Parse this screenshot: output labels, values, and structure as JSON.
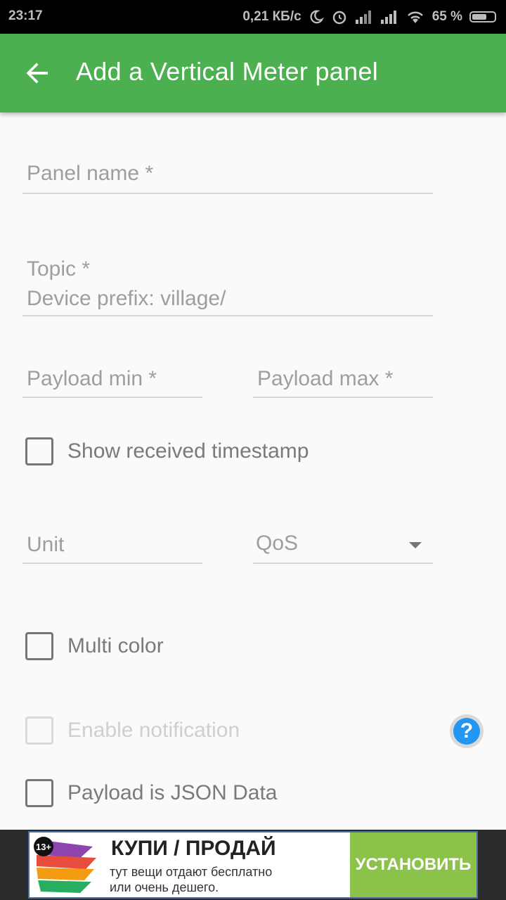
{
  "status_bar": {
    "time": "23:17",
    "speed": "0,21 КБ/с",
    "battery": "65 %",
    "battery_level": 0.65
  },
  "app_bar": {
    "title": "Add a Vertical Meter panel",
    "back_icon": "arrow-back-icon",
    "background": "#4caf50"
  },
  "form": {
    "panel_name": {
      "label": "Panel name *",
      "value": ""
    },
    "topic": {
      "label": "Topic *",
      "hint": "Device prefix: village/",
      "value": ""
    },
    "payload_min": {
      "label": "Payload min *",
      "value": ""
    },
    "payload_max": {
      "label": "Payload max *",
      "value": ""
    },
    "show_timestamp": {
      "label": "Show received timestamp",
      "checked": false
    },
    "unit": {
      "label": "Unit",
      "value": ""
    },
    "qos": {
      "label": "QoS",
      "selected": ""
    },
    "multi_color": {
      "label": "Multi color",
      "checked": false
    },
    "enable_notification": {
      "label": "Enable notification",
      "checked": false,
      "disabled": true
    },
    "payload_json": {
      "label": "Payload is JSON Data",
      "checked": false
    },
    "help_icon": "?"
  },
  "ad": {
    "age_rating": "13+",
    "headline": "КУПИ / ПРОДАЙ",
    "line1": "тут вещи отдают бесплатно",
    "line2": "или очень дешего.",
    "button": "УСТАНОВИТЬ"
  }
}
